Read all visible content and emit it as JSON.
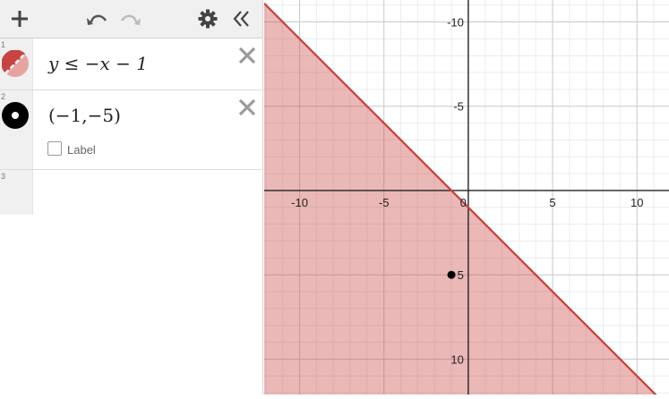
{
  "toolbar": {
    "add_icon": "plus-icon",
    "undo_icon": "undo-icon",
    "redo_icon": "redo-icon",
    "settings_icon": "gear-icon",
    "collapse_icon": "double-chevron-left-icon"
  },
  "expressions": [
    {
      "number": "1",
      "latex_display": "y ≤ −x − 1",
      "color": "#c74440"
    },
    {
      "number": "2",
      "latex_display": "(−1,−5)",
      "color": "#000000",
      "label_checkbox_text": "Label",
      "label_checked": false
    },
    {
      "number": "3",
      "latex_display": ""
    }
  ],
  "graph": {
    "x_tick_labels": [
      "-10",
      "-5",
      "0",
      "5",
      "10"
    ],
    "y_tick_labels": [
      "10",
      "5",
      "-5",
      "-10"
    ],
    "shade_color": "#c74440"
  },
  "chart_data": {
    "type": "scatter",
    "xlim": [
      -12.1,
      11.9
    ],
    "ylim": [
      -12.1,
      11.3
    ],
    "grid": true,
    "x_ticks": [
      -10,
      -5,
      0,
      5,
      10
    ],
    "y_ticks": [
      -10,
      -5,
      5,
      10
    ],
    "inequality": {
      "expression": "y ≤ −x − 1",
      "slope": -1,
      "intercept": -1,
      "region": "below"
    },
    "points": [
      {
        "x": -1,
        "y": -5
      }
    ]
  }
}
